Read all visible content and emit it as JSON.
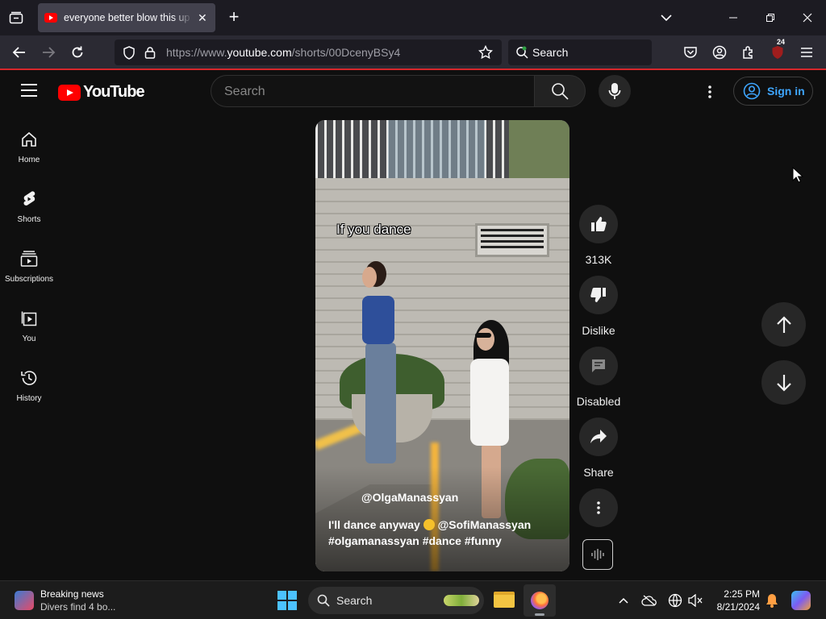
{
  "browser": {
    "tab": {
      "title": "everyone better blow this up and make it go viral - YouTube",
      "close": "✕"
    },
    "new_tab": "+",
    "url": {
      "prefix": "https://www.",
      "domain": "youtube.com",
      "path": "/shorts/00DcenyBSy4"
    },
    "search_placeholder": "Search",
    "extension_badge": "24"
  },
  "youtube": {
    "logo_text": "YouTube",
    "search_placeholder": "Search",
    "sign_in": "Sign in",
    "sidebar": [
      {
        "label": "Home",
        "icon": "home-icon"
      },
      {
        "label": "Shorts",
        "icon": "shorts-icon"
      },
      {
        "label": "Subscriptions",
        "icon": "subscriptions-icon"
      },
      {
        "label": "You",
        "icon": "you-icon"
      },
      {
        "label": "History",
        "icon": "history-icon"
      }
    ],
    "video": {
      "overlay_caption": "If you dance",
      "channel": "@OlgaManassyan",
      "description_line1": "I'll dance anyway",
      "description_mention": "@SofiManassyan",
      "description_line2": "#olgamanassyan #dance #funny"
    },
    "actions": {
      "like_count": "313K",
      "dislike": "Dislike",
      "comments": "Disabled",
      "share": "Share"
    }
  },
  "taskbar": {
    "news_title": "Breaking news",
    "news_subtitle": "Divers find 4 bo...",
    "search_placeholder": "Search",
    "time": "2:25 PM",
    "date": "8/21/2024"
  },
  "colors": {
    "yt_red": "#ff0000",
    "link_blue": "#3ea6ff",
    "browser_accent": "#d7262b"
  }
}
